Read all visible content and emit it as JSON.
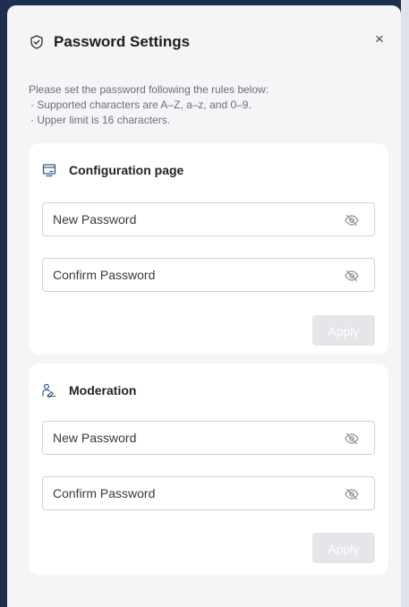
{
  "dialog": {
    "title": "Password Settings",
    "title_icon": "shield-check-icon",
    "close_icon": "close-icon",
    "close_glyph": "×"
  },
  "rules": {
    "intro": "Please set the password following the rules below:",
    "items": [
      "· Supported characters are A–Z, a–z, and 0–9.",
      "· Upper limit is 16 characters."
    ]
  },
  "sections": [
    {
      "title": "Configuration page",
      "icon": "monitor-icon",
      "new_password_placeholder": "New Password",
      "confirm_password_placeholder": "Confirm Password",
      "apply_label": "Apply"
    },
    {
      "title": "Moderation",
      "icon": "moderator-icon",
      "new_password_placeholder": "New Password",
      "confirm_password_placeholder": "Confirm Password",
      "apply_label": "Apply"
    }
  ],
  "colors": {
    "accent": "#2f5a8f",
    "panel_bg": "#f4f5f7",
    "card_bg": "#ffffff",
    "apply_disabled_bg": "#e4e6e9"
  }
}
